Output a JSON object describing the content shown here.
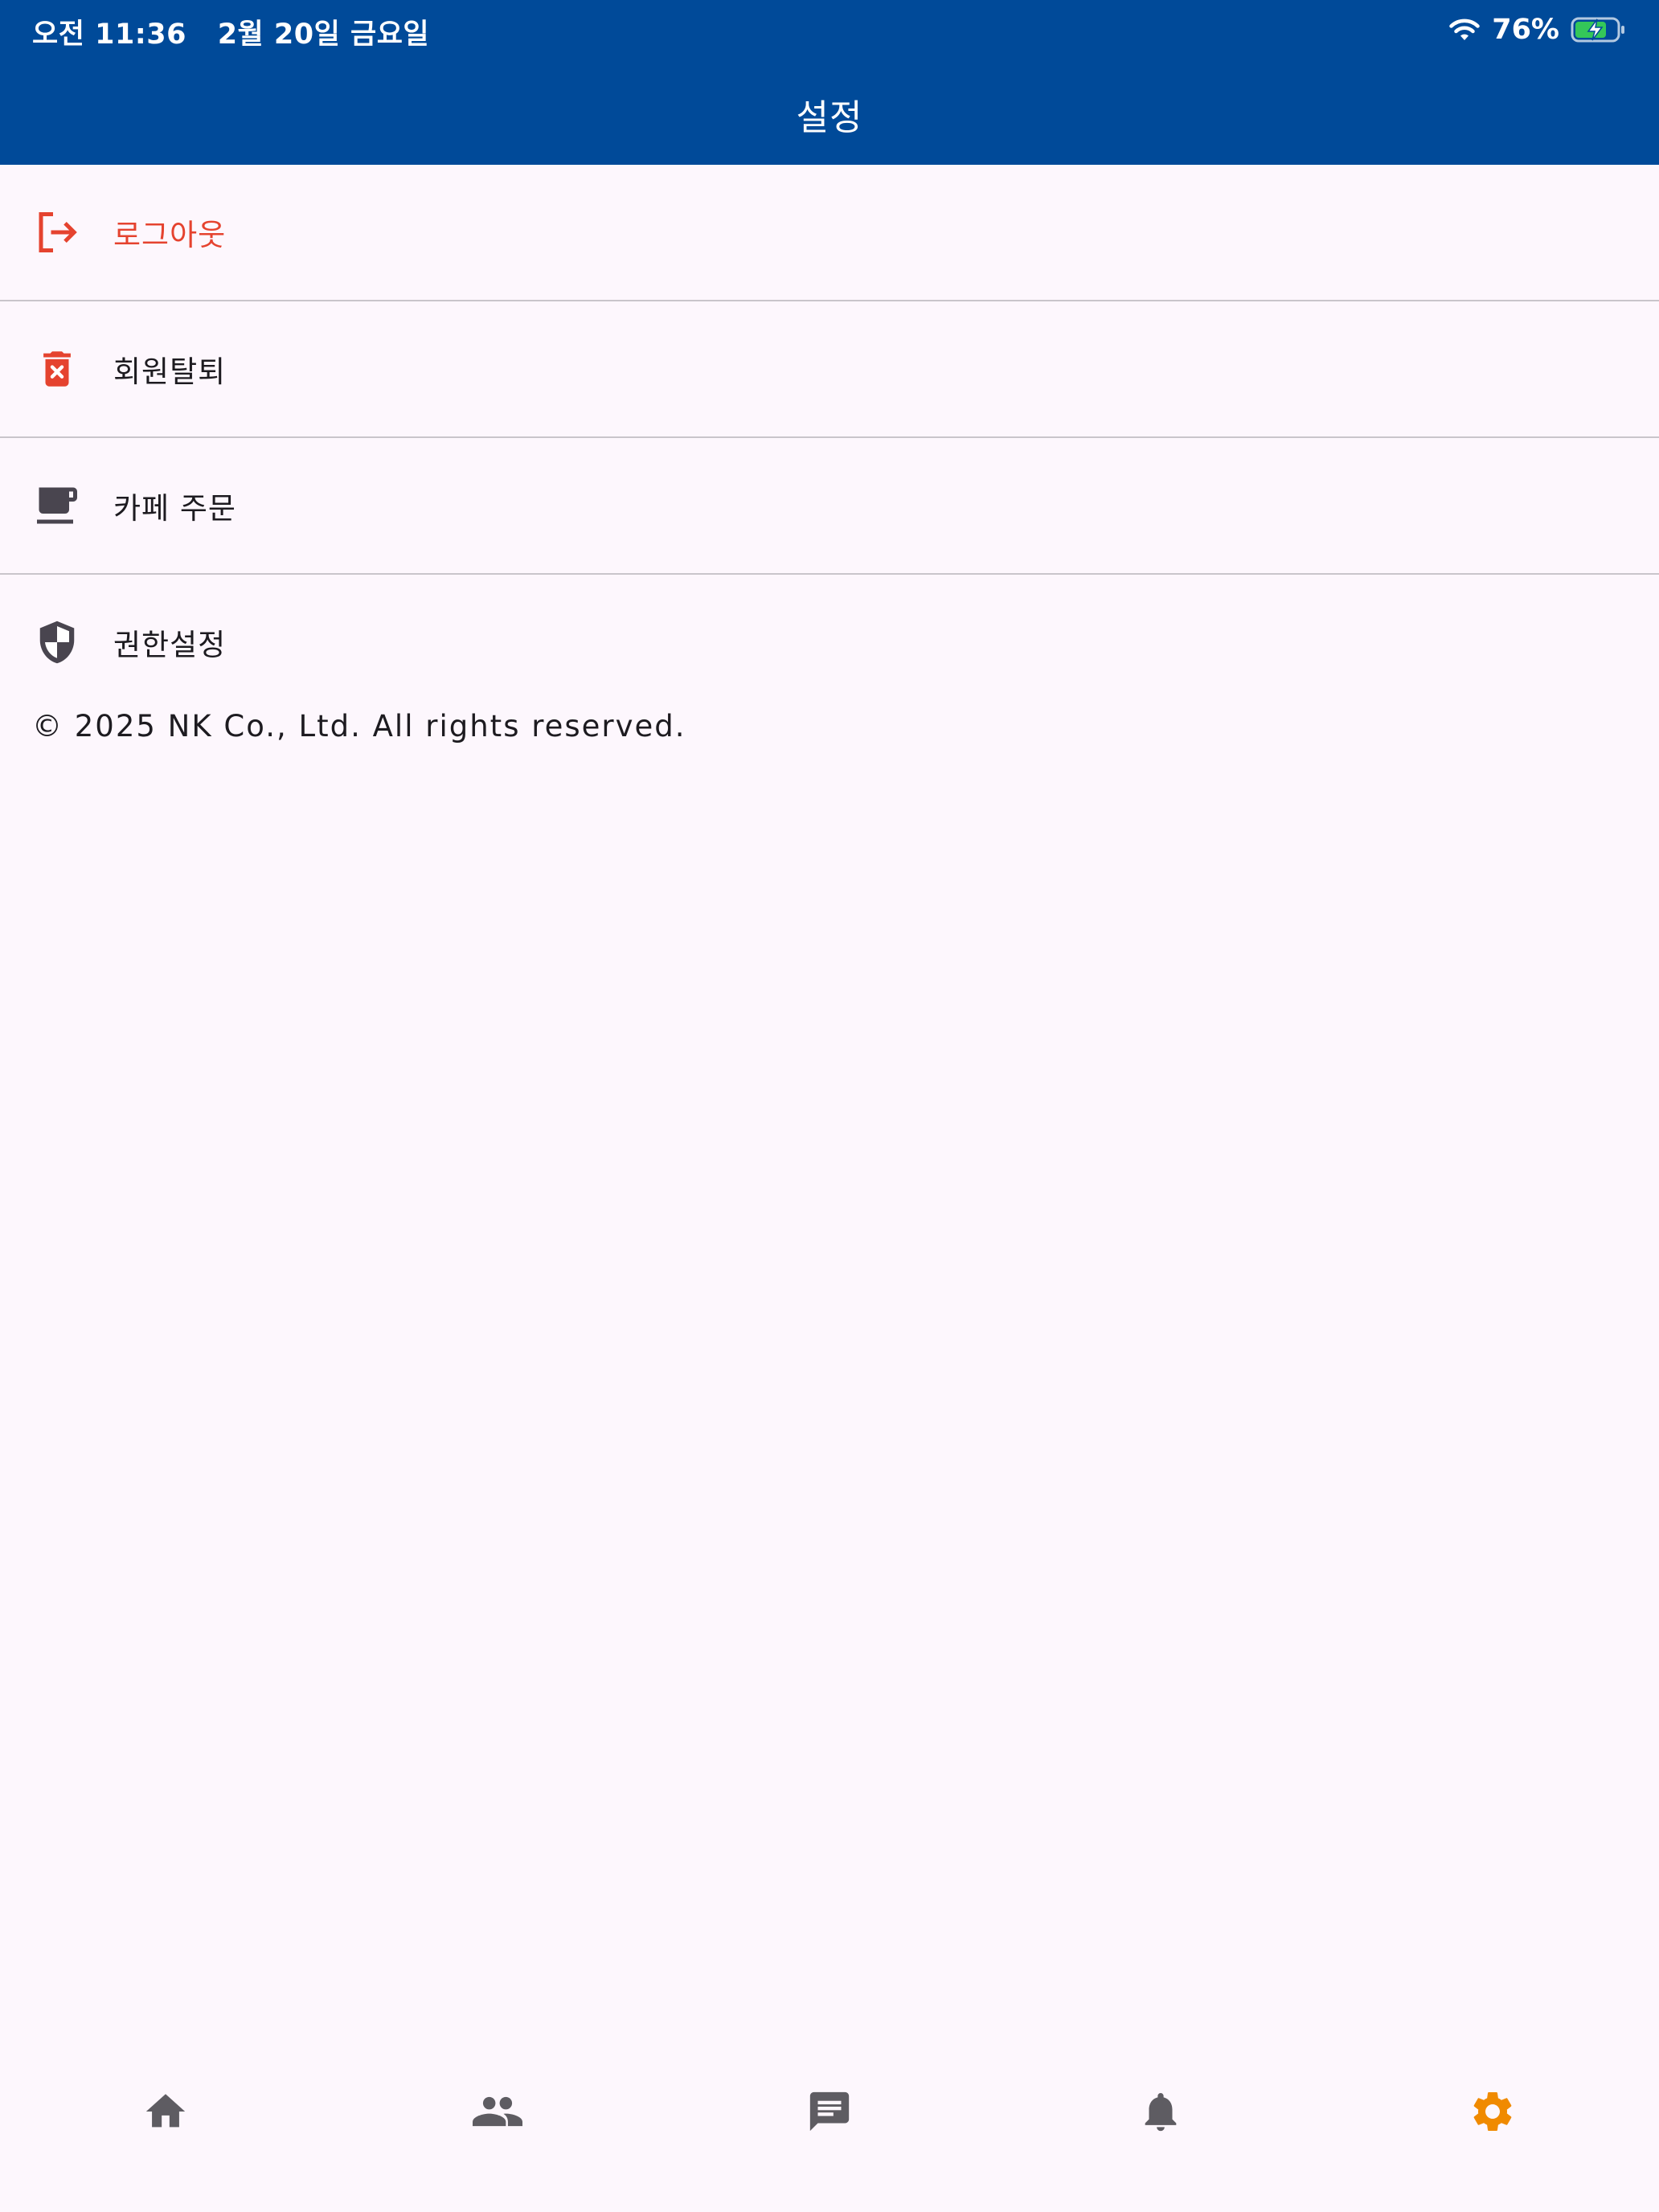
{
  "status_bar": {
    "time": "오전 11:36",
    "date": "2월 20일 금요일",
    "battery": "76%",
    "icons": [
      "wifi-icon",
      "battery-charging-icon"
    ]
  },
  "app_bar": {
    "title": "설정"
  },
  "settings": {
    "items": [
      {
        "label": "로그아웃",
        "icon": "logout-icon",
        "color": "#E5432F"
      },
      {
        "label": "회원탈퇴",
        "icon": "delete-account-icon",
        "color": "#E5432F"
      },
      {
        "label": "카페 주문",
        "icon": "coffee-icon",
        "color": "#1D1B20"
      },
      {
        "label": "권한설정",
        "icon": "shield-icon",
        "color": "#1D1B20"
      }
    ]
  },
  "footer": {
    "copyright": "© 2025 NK Co., Ltd. All rights reserved."
  },
  "bottom_nav": {
    "items": [
      {
        "icon": "home-icon",
        "active": false
      },
      {
        "icon": "people-icon",
        "active": false
      },
      {
        "icon": "chat-icon",
        "active": false
      },
      {
        "icon": "bell-icon",
        "active": false
      },
      {
        "icon": "gear-icon",
        "active": true
      }
    ],
    "colors": {
      "active": "#F08A00",
      "inactive": "#5E5C62"
    }
  },
  "colors": {
    "primary": "#004A99",
    "background": "#FDF7FD",
    "danger": "#E5432F",
    "text": "#1D1B20",
    "divider": "#C9C5CB"
  }
}
